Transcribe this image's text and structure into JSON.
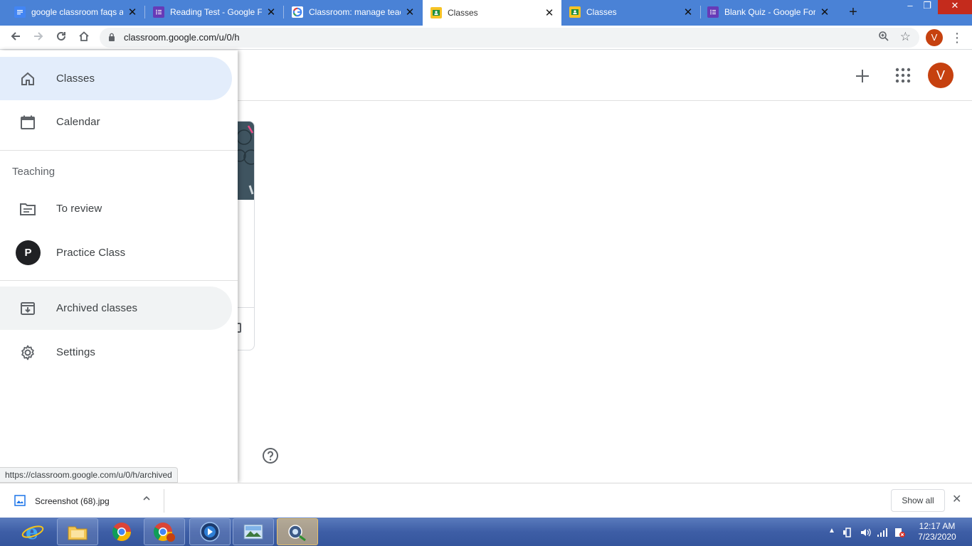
{
  "browser": {
    "tabs": [
      {
        "title": "google classroom faqs a",
        "favicon": "docs-icon",
        "active": false
      },
      {
        "title": "Reading Test - Google Fo",
        "favicon": "forms-icon",
        "active": false
      },
      {
        "title": "Classroom: manage teac",
        "favicon": "google-icon",
        "active": false
      },
      {
        "title": "Classes",
        "favicon": "classroom-icon",
        "active": true
      },
      {
        "title": "Classes",
        "favicon": "classroom-icon",
        "active": false
      },
      {
        "title": "Blank Quiz - Google For",
        "favicon": "forms-icon",
        "active": false
      }
    ],
    "url": "classroom.google.com/u/0/h",
    "profile_initial": "V"
  },
  "app": {
    "header": {
      "avatar_initial": "V"
    },
    "drawer": {
      "top_items": [
        {
          "label": "Classes",
          "icon": "home-icon",
          "selected": true
        },
        {
          "label": "Calendar",
          "icon": "calendar-icon",
          "selected": false
        }
      ],
      "teaching_section": {
        "title": "Teaching",
        "items": [
          {
            "label": "To review",
            "icon": "to-review-icon"
          },
          {
            "label": "Practice Class",
            "avatar_initial": "P"
          }
        ]
      },
      "bottom_items": [
        {
          "label": "Archived classes",
          "icon": "archive-icon",
          "hovered": true
        },
        {
          "label": "Settings",
          "icon": "gear-icon"
        }
      ]
    }
  },
  "status_bar": {
    "url": "https://classroom.google.com/u/0/h/archived"
  },
  "download_shelf": {
    "file_name": "Screenshot (68).jpg",
    "show_all_label": "Show all"
  },
  "taskbar": {
    "time": "12:17 AM",
    "date": "7/23/2020"
  },
  "colors": {
    "tabstrip": "#4a82d6",
    "selected_nav": "#e3edfb",
    "avatar": "#c6410f"
  }
}
